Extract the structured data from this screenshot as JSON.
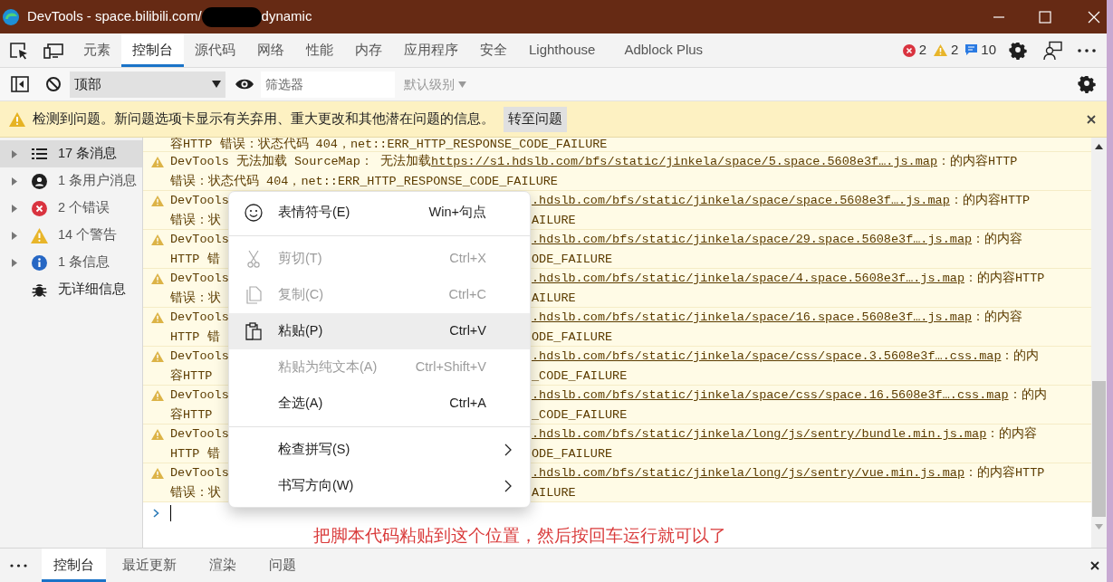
{
  "window": {
    "title_prefix": "DevTools - space.bilibili.com/",
    "title_suffix": "dynamic"
  },
  "main_tabs": [
    {
      "label": "元素",
      "selected": false
    },
    {
      "label": "控制台",
      "selected": true
    },
    {
      "label": "源代码",
      "selected": false
    },
    {
      "label": "网络",
      "selected": false
    },
    {
      "label": "性能",
      "selected": false
    },
    {
      "label": "内存",
      "selected": false
    },
    {
      "label": "应用程序",
      "selected": false
    },
    {
      "label": "安全",
      "selected": false
    },
    {
      "label": "Lighthouse",
      "selected": false
    },
    {
      "label": "Adblock Plus",
      "selected": false
    }
  ],
  "issue_counts": [
    {
      "kind": "error",
      "count": "2"
    },
    {
      "kind": "warning",
      "count": "2"
    },
    {
      "kind": "info",
      "count": "10"
    }
  ],
  "toolbar": {
    "context": "顶部",
    "filter_placeholder": "筛选器",
    "levels": "默认级别"
  },
  "banner": {
    "text": "检测到问题。新问题选项卡显示有关弃用、重大更改和其他潜在问题的信息。",
    "button": "转至问题"
  },
  "sidebar": {
    "items": [
      {
        "kind": "messages",
        "label": "17 条消息",
        "selected": true,
        "expandable": true
      },
      {
        "kind": "user",
        "label": "1 条用户消息",
        "selected": false,
        "expandable": true
      },
      {
        "kind": "errors",
        "label": "2 个错误",
        "selected": false,
        "expandable": true
      },
      {
        "kind": "warnings",
        "label": "14 个警告",
        "selected": false,
        "expandable": true
      },
      {
        "kind": "info",
        "label": "1 条信息",
        "selected": false,
        "expandable": true
      },
      {
        "kind": "verbose",
        "label": "无详细信息",
        "selected": false,
        "expandable": false
      }
    ]
  },
  "messages": [
    {
      "kind": "partial",
      "text": "容HTTP 错误：状态代码 404，net::ERR_HTTP_RESPONSE_CODE_FAILURE"
    },
    {
      "kind": "full",
      "prefix": "DevTools 无法加载 SourceMap： 无法加载 ",
      "link": "https://s1.hdslb.com/bfs/static/jinkela/space/5.space.5608e3f….js.map",
      "suffix": "：的内容HTTP",
      "line2": "错误：状态代码 404，net::ERR_HTTP_RESPONSE_CODE_FAILURE"
    },
    {
      "kind": "covered",
      "line1_left": "DevTools",
      "link": ".hdslb.com/bfs/static/jinkela/space/space.5608e3f….js.map",
      "suffix": "：的内容HTTP",
      "line2_left": "错误：状",
      "line2_right": "AILURE"
    },
    {
      "kind": "covered",
      "line1_left": "DevTools",
      "link": ".hdslb.com/bfs/static/jinkela/space/29.space.5608e3f….js.map",
      "suffix": "：的内容",
      "line2_left": "HTTP 错",
      "line2_right": "ODE_FAILURE"
    },
    {
      "kind": "covered",
      "line1_left": "DevTools",
      "link": ".hdslb.com/bfs/static/jinkela/space/4.space.5608e3f….js.map",
      "suffix": "：的内容HTTP",
      "line2_left": "错误：状",
      "line2_right": "AILURE"
    },
    {
      "kind": "covered",
      "line1_left": "DevTools",
      "link": ".hdslb.com/bfs/static/jinkela/space/16.space.5608e3f….js.map",
      "suffix": "：的内容",
      "line2_left": "HTTP 错",
      "line2_right": "ODE_FAILURE"
    },
    {
      "kind": "covered",
      "line1_left": "DevTools",
      "link": ".hdslb.com/bfs/static/jinkela/space/css/space.3.5608e3f….css.map",
      "suffix": "：的内",
      "line2_left": "容HTTP",
      "line2_right": "_CODE_FAILURE"
    },
    {
      "kind": "covered",
      "line1_left": "DevTools",
      "link": ".hdslb.com/bfs/static/jinkela/space/css/space.16.5608e3f….css.map",
      "suffix": "：的内",
      "line2_left": "容HTTP",
      "line2_right": "_CODE_FAILURE"
    },
    {
      "kind": "covered",
      "line1_left": "DevTools",
      "link": ".hdslb.com/bfs/static/jinkela/long/js/sentry/bundle.min.js.map",
      "suffix": "：的内容",
      "line2_left": "HTTP 错",
      "line2_right": "ODE_FAILURE"
    },
    {
      "kind": "covered",
      "line1_left": "DevTools",
      "link": ".hdslb.com/bfs/static/jinkela/long/js/sentry/vue.min.js.map",
      "suffix": "：的内容HTTP",
      "line2_left": "错误：状",
      "line2_right": "AILURE"
    }
  ],
  "annotation": "把脚本代码粘贴到这个位置，然后按回车运行就可以了",
  "context_menu": {
    "items": [
      {
        "kind": "emoji",
        "label": "表情符号(E)",
        "shortcut": "Win+句点",
        "disabled": false,
        "selected": false,
        "submenu": false
      },
      {
        "kind": "divider"
      },
      {
        "kind": "cut",
        "label": "剪切(T)",
        "shortcut": "Ctrl+X",
        "disabled": true,
        "selected": false,
        "submenu": false
      },
      {
        "kind": "copy",
        "label": "复制(C)",
        "shortcut": "Ctrl+C",
        "disabled": true,
        "selected": false,
        "submenu": false
      },
      {
        "kind": "paste",
        "label": "粘贴(P)",
        "shortcut": "Ctrl+V",
        "disabled": false,
        "selected": true,
        "submenu": false
      },
      {
        "kind": "plain",
        "label": "粘贴为纯文本(A)",
        "shortcut": "Ctrl+Shift+V",
        "disabled": true,
        "selected": false,
        "submenu": false
      },
      {
        "kind": "plain",
        "label": "全选(A)",
        "shortcut": "Ctrl+A",
        "disabled": false,
        "selected": false,
        "submenu": false
      },
      {
        "kind": "divider"
      },
      {
        "kind": "plain",
        "label": "检查拼写(S)",
        "disabled": false,
        "selected": false,
        "submenu": true
      },
      {
        "kind": "plain",
        "label": "书写方向(W)",
        "disabled": false,
        "selected": false,
        "submenu": true
      }
    ]
  },
  "drawer_tabs": [
    {
      "label": "控制台",
      "selected": true
    },
    {
      "label": "最近更新",
      "selected": false
    },
    {
      "label": "渲染",
      "selected": false
    },
    {
      "label": "问题",
      "selected": false
    }
  ]
}
